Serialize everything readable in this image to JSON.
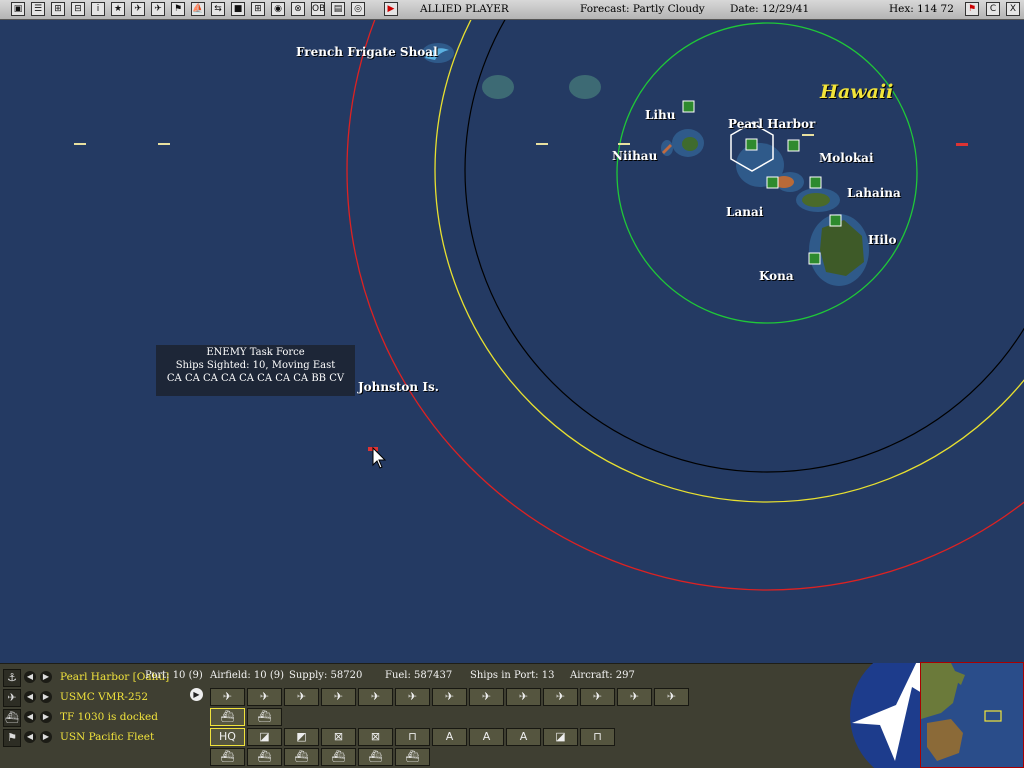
{
  "topbar": {
    "buttons": [
      "▣",
      "☰",
      "⊞",
      "⊟",
      "i",
      "★",
      "✈",
      "✈",
      "⚑",
      "⛵",
      "⇆",
      "■",
      "⊞",
      "◉",
      "⊗",
      "OB",
      "▤",
      "◎"
    ],
    "player": "ALLIED PLAYER",
    "forecast": "Forecast: Partly Cloudy",
    "date": "Date: 12/29/41",
    "hex": "Hex: 114 72",
    "right_buttons": [
      "⚑",
      "C",
      "X"
    ]
  },
  "map": {
    "places": {
      "french_frigate": "French Frigate Shoal",
      "hawaii": "Hawaii",
      "lihu": "Lihu",
      "niihau": "Niihau",
      "pearl_harbor": "Pearl Harbor",
      "molokai": "Molokai",
      "lanai": "Lanai",
      "lahaina": "Lahaina",
      "hilo": "Hilo",
      "kona": "Kona",
      "johnston": "Johnston Is."
    },
    "tooltip": {
      "line1": "ENEMY Task Force",
      "line2": "Ships Sighted: 10, Moving East",
      "line3": "CA CA CA CA CA CA CA CA BB CV"
    }
  },
  "panel": {
    "rows": [
      {
        "icon": "⚓",
        "text": "Pearl Harbor [Oahu]"
      },
      {
        "icon": "✈",
        "text": "USMC VMR-252"
      },
      {
        "icon": "⛴",
        "text": "TF 1030 is docked"
      },
      {
        "icon": "⚑",
        "text": "USN Pacific Fleet"
      }
    ],
    "stats": {
      "port": "Port: 10 (9)",
      "airfield": "Airfield: 10 (9)",
      "supply": "Supply: 58720",
      "fuel": "Fuel: 587437",
      "ships": "Ships in Port: 13",
      "aircraft": "Aircraft: 297"
    },
    "play_icon": "▶",
    "aircraft_buttons": [
      "✈",
      "✈",
      "✈",
      "✈",
      "✈",
      "✈",
      "✈",
      "✈",
      "✈",
      "✈",
      "✈",
      "✈",
      "✈"
    ],
    "ship_buttons": [
      "⛴",
      "⛴"
    ],
    "command_buttons": [
      "HQ",
      "◪",
      "◩",
      "⊠",
      "⊠",
      "⊓",
      "A",
      "A",
      "A",
      "◪",
      "⊓"
    ],
    "unit_buttons": [
      "⛴",
      "⛴",
      "⛴",
      "⛴",
      "⛴",
      "⛴"
    ]
  }
}
